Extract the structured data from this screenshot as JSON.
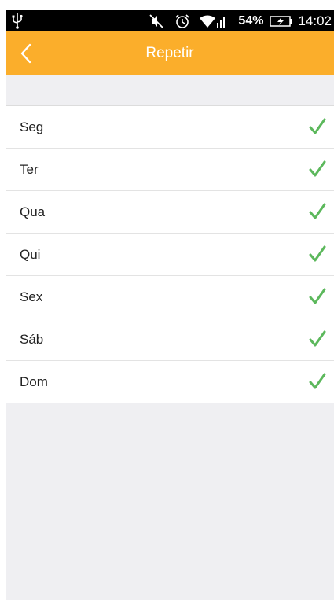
{
  "status_bar": {
    "battery_percent": "54%",
    "time": "14:02",
    "icons": [
      "usb-icon",
      "mute-icon",
      "alarm-icon",
      "wifi-icon",
      "signal-icon",
      "battery-charging-icon"
    ]
  },
  "app_bar": {
    "title": "Repetir",
    "back_icon": "chevron-left-icon",
    "color": "#fbae2b"
  },
  "days": [
    {
      "label": "Seg",
      "checked": true
    },
    {
      "label": "Ter",
      "checked": true
    },
    {
      "label": "Qua",
      "checked": true
    },
    {
      "label": "Qui",
      "checked": true
    },
    {
      "label": "Sex",
      "checked": true
    },
    {
      "label": "Sáb",
      "checked": true
    },
    {
      "label": "Dom",
      "checked": true
    }
  ],
  "colors": {
    "accent": "#fbae2b",
    "check": "#5cb85c",
    "background": "#efeff2"
  }
}
